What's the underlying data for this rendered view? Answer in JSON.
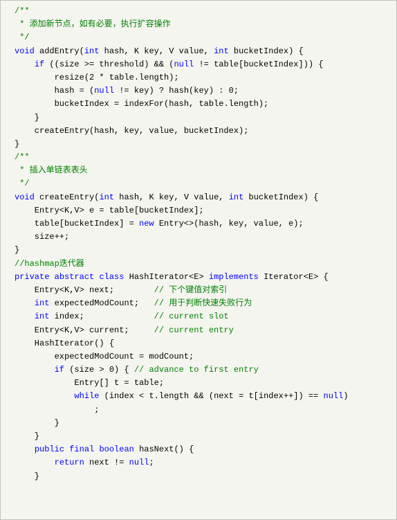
{
  "code": {
    "l1": "/**",
    "l2": " * 添加新节点，如有必要，执行扩容操作",
    "l3": " */",
    "l4a": "void",
    "l4b": " addEntry(",
    "l4c": "int",
    "l4d": " hash, K key, V value, ",
    "l4e": "int",
    "l4f": " bucketIndex) {",
    "l5a": "    ",
    "l5b": "if",
    "l5c": " ((size >= threshold) && (",
    "l5d": "null",
    "l5e": " != table[bucketIndex])) {",
    "l6a": "        resize(",
    "l6b": "2",
    "l6c": " * table.length);",
    "l7a": "        hash = (",
    "l7b": "null",
    "l7c": " != key) ? hash(key) : ",
    "l7d": "0",
    "l7e": ";",
    "l8": "        bucketIndex = indexFor(hash, table.length);",
    "l9": "    }",
    "l10": "",
    "l11": "    createEntry(hash, key, value, bucketIndex);",
    "l12": "}",
    "l13": "",
    "l14": "/**",
    "l15": " * 插入单链表表头",
    "l16": " */",
    "l17a": "void",
    "l17b": " createEntry(",
    "l17c": "int",
    "l17d": " hash, K key, V value, ",
    "l17e": "int",
    "l17f": " bucketIndex) {",
    "l18": "    Entry<K,V> e = table[bucketIndex];",
    "l19a": "    table[bucketIndex] = ",
    "l19b": "new",
    "l19c": " Entry<>(hash, key, value, e);",
    "l20": "    size++;",
    "l21": "}",
    "l22": "",
    "l23": "//hashmap迭代器",
    "l24a": "private",
    "l24b": " ",
    "l24c": "abstract",
    "l24d": " ",
    "l24e": "class",
    "l24f": " HashIterator<E> ",
    "l24g": "implements",
    "l24h": " Iterator<E> {",
    "l25a": "    Entry<K,V> next;        ",
    "l25b": "// 下个键值对索引",
    "l26a": "    ",
    "l26b": "int",
    "l26c": " expectedModCount;   ",
    "l26d": "// 用于判断快速失败行为",
    "l27a": "    ",
    "l27b": "int",
    "l27c": " index;              ",
    "l27d": "// current slot",
    "l28a": "    Entry<K,V> current;     ",
    "l28b": "// current entry",
    "l29": "",
    "l30": "    HashIterator() {",
    "l31": "        expectedModCount = modCount;",
    "l32a": "        ",
    "l32b": "if",
    "l32c": " (size > ",
    "l32d": "0",
    "l32e": ") { ",
    "l32f": "// advance to first entry",
    "l33": "            Entry[] t = table;",
    "l34a": "            ",
    "l34b": "while",
    "l34c": " (index < t.length && (next = t[index++]) == ",
    "l34d": "null",
    "l34e": ")",
    "l35": "                ;",
    "l36": "        }",
    "l37": "    }",
    "l38": "",
    "l39a": "    ",
    "l39b": "public",
    "l39c": " ",
    "l39d": "final",
    "l39e": " ",
    "l39f": "boolean",
    "l39g": " hasNext() {",
    "l40a": "        ",
    "l40b": "return",
    "l40c": " next != ",
    "l40d": "null",
    "l40e": ";",
    "l41": "    }"
  }
}
